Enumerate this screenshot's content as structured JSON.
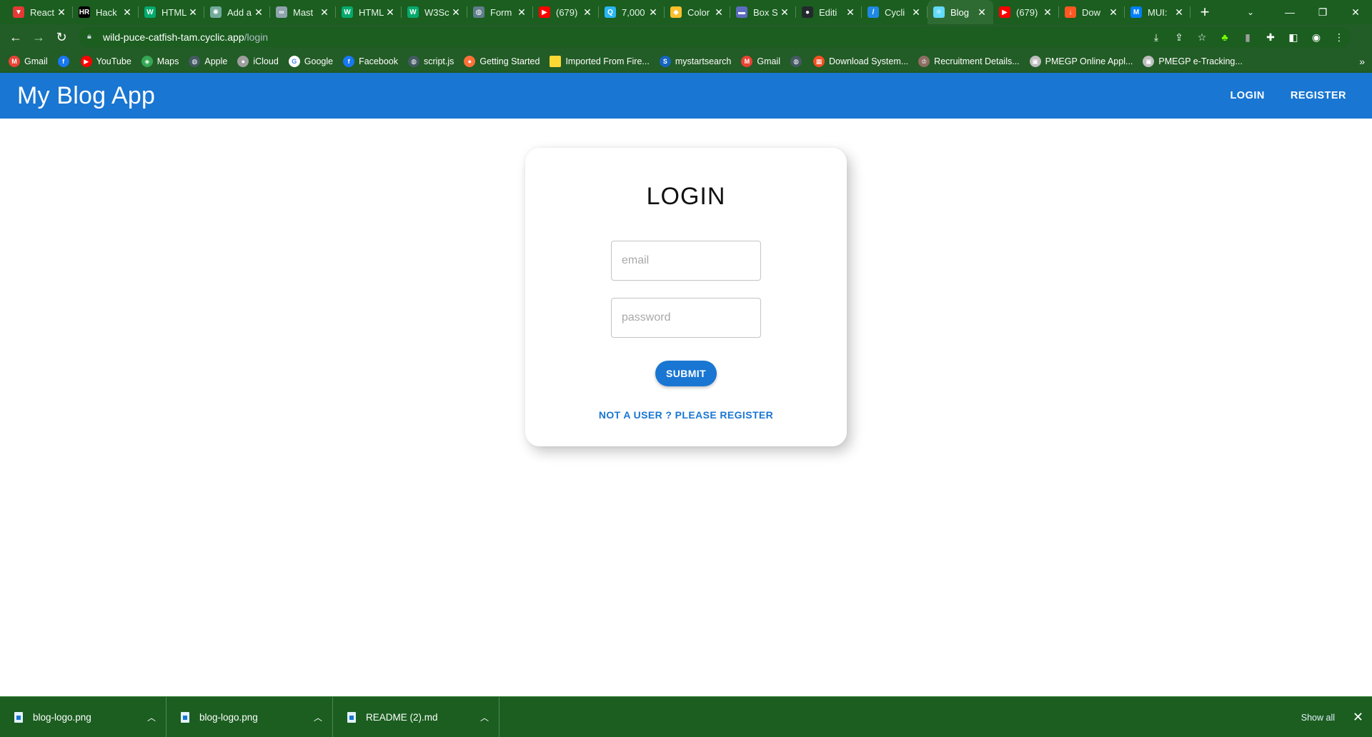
{
  "browser": {
    "tabs": [
      {
        "title": "React",
        "icon": "react-icon",
        "color": "#e53935",
        "glyph": "▼"
      },
      {
        "title": "Hack",
        "icon": "hackerrank-icon",
        "color": "#000000",
        "glyph": "HR"
      },
      {
        "title": "HTML",
        "icon": "w3schools-icon",
        "color": "#04aa6d",
        "glyph": "W"
      },
      {
        "title": "Add a",
        "icon": "chatgpt-icon",
        "color": "#74aa9c",
        "glyph": "✺"
      },
      {
        "title": "Mast",
        "icon": "link-icon",
        "color": "#90a4ae",
        "glyph": "∞"
      },
      {
        "title": "HTML",
        "icon": "w3schools-icon",
        "color": "#04aa6d",
        "glyph": "W"
      },
      {
        "title": "W3Sc",
        "icon": "w3schools-icon",
        "color": "#04aa6d",
        "glyph": "W"
      },
      {
        "title": "Form",
        "icon": "globe-icon",
        "color": "#607d8b",
        "glyph": "◍"
      },
      {
        "title": "(679)",
        "icon": "youtube-icon",
        "color": "#ff0000",
        "glyph": "▶"
      },
      {
        "title": "7,000",
        "icon": "search-circle-icon",
        "color": "#29b6f6",
        "glyph": "Q"
      },
      {
        "title": "Color",
        "icon": "shield-icon",
        "color": "#fbc02d",
        "glyph": "◆"
      },
      {
        "title": "Box S",
        "icon": "window-icon",
        "color": "#5c6bc0",
        "glyph": "▬"
      },
      {
        "title": "Editi",
        "icon": "github-icon",
        "color": "#24292e",
        "glyph": "●"
      },
      {
        "title": "Cycli",
        "icon": "cyclic-icon",
        "color": "#1e88e5",
        "glyph": "/"
      },
      {
        "title": "Blog",
        "icon": "react-icon",
        "color": "#61dafb",
        "glyph": "⚛",
        "active": true
      },
      {
        "title": "(679)",
        "icon": "youtube-icon",
        "color": "#ff0000",
        "glyph": "▶"
      },
      {
        "title": "Dow",
        "icon": "download-app-icon",
        "color": "#ff5722",
        "glyph": "↓"
      },
      {
        "title": "MUI:",
        "icon": "mui-icon",
        "color": "#007fff",
        "glyph": "M"
      }
    ],
    "url_host": "wild-puce-catfish-tam.cyclic.app",
    "url_path": "/login",
    "bookmarks": [
      {
        "label": "Gmail",
        "icon": "gmail-icon",
        "color": "#ea4335",
        "glyph": "M"
      },
      {
        "label": "",
        "icon": "facebook-icon",
        "color": "#1877f2",
        "glyph": "f"
      },
      {
        "label": "YouTube",
        "icon": "youtube-icon",
        "color": "#ff0000",
        "glyph": "▶"
      },
      {
        "label": "Maps",
        "icon": "maps-icon",
        "color": "#34a853",
        "glyph": "◈"
      },
      {
        "label": "Apple",
        "icon": "globe-icon",
        "color": "#455a64",
        "glyph": "◍"
      },
      {
        "label": "iCloud",
        "icon": "apple-icon",
        "color": "#9e9e9e",
        "glyph": "●"
      },
      {
        "label": "Google",
        "icon": "google-icon",
        "color": "#ffffff",
        "glyph": "G"
      },
      {
        "label": "Facebook",
        "icon": "facebook-icon",
        "color": "#1877f2",
        "glyph": "f"
      },
      {
        "label": "script.js",
        "icon": "globe-icon",
        "color": "#455a64",
        "glyph": "◍"
      },
      {
        "label": "Getting Started",
        "icon": "firefox-icon",
        "color": "#ff7139",
        "glyph": "●"
      },
      {
        "label": "Imported From Fire...",
        "icon": "folder-icon",
        "color": "#fdd835",
        "glyph": ""
      },
      {
        "label": "mystartsearch",
        "icon": "mystartsearch-icon",
        "color": "#1565c0",
        "glyph": "S"
      },
      {
        "label": "Gmail",
        "icon": "gmail-icon",
        "color": "#ea4335",
        "glyph": "M"
      },
      {
        "label": "",
        "icon": "globe-icon",
        "color": "#455a64",
        "glyph": "◍"
      },
      {
        "label": "Download System...",
        "icon": "microsoft-icon",
        "color": "#f25022",
        "glyph": "▦"
      },
      {
        "label": "Recruitment Details...",
        "icon": "emblem-icon",
        "color": "#8d6e63",
        "glyph": "♔"
      },
      {
        "label": "PMEGP Online Appl...",
        "icon": "pmegp-icon",
        "color": "#bdbdbd",
        "glyph": "▣"
      },
      {
        "label": "PMEGP e-Tracking...",
        "icon": "pmegp-icon",
        "color": "#bdbdbd",
        "glyph": "▣"
      }
    ]
  },
  "app": {
    "title": "My Blog App",
    "nav_login": "LOGIN",
    "nav_register": "REGISTER",
    "brand_color": "#1976d2"
  },
  "login": {
    "heading": "LOGIN",
    "email_placeholder": "email",
    "password_placeholder": "password",
    "submit_label": "SUBMIT",
    "register_link": "NOT A USER ? PLEASE REGISTER"
  },
  "downloads": {
    "items": [
      {
        "name": "blog-logo.png"
      },
      {
        "name": "blog-logo.png"
      },
      {
        "name": "README (2).md"
      }
    ],
    "show_all": "Show all"
  }
}
